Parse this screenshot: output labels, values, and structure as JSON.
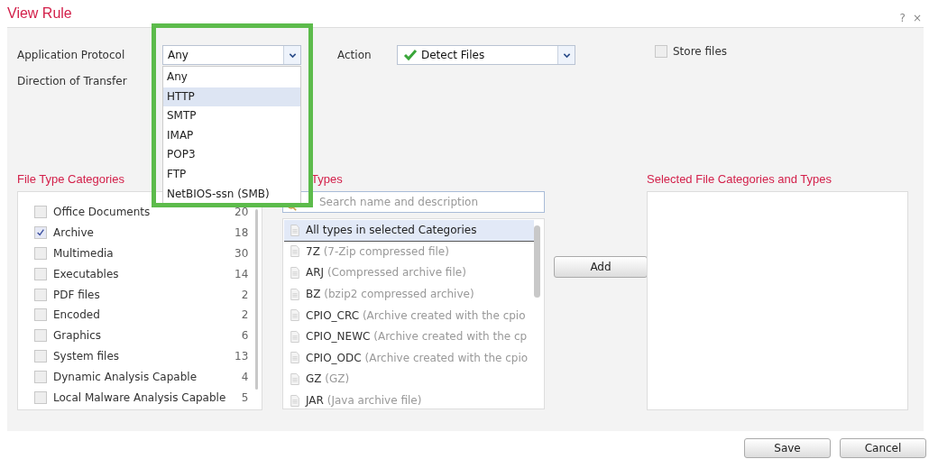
{
  "window": {
    "title": "View Rule",
    "help": "?",
    "close": "×"
  },
  "form": {
    "protocol_label": "Application Protocol",
    "protocol_value": "Any",
    "action_label": "Action",
    "action_value": "Detect Files",
    "store_files": {
      "label": "Store files",
      "checked": false
    },
    "direction_label": "Direction of Transfer"
  },
  "protocol_dropdown": {
    "highlighted": true,
    "options": [
      {
        "label": "Any",
        "selected": false
      },
      {
        "label": "HTTP",
        "selected": true
      },
      {
        "label": "SMTP",
        "selected": false
      },
      {
        "label": "IMAP",
        "selected": false
      },
      {
        "label": "POP3",
        "selected": false
      },
      {
        "label": "FTP",
        "selected": false
      },
      {
        "label": "NetBIOS-ssn (SMB)",
        "selected": false
      }
    ]
  },
  "categories": {
    "heading": "File Type Categories",
    "items": [
      {
        "label": "Office Documents",
        "count": "20",
        "checked": false
      },
      {
        "label": "Archive",
        "count": "18",
        "checked": true
      },
      {
        "label": "Multimedia",
        "count": "30",
        "checked": false
      },
      {
        "label": "Executables",
        "count": "14",
        "checked": false
      },
      {
        "label": "PDF files",
        "count": "2",
        "checked": false
      },
      {
        "label": "Encoded",
        "count": "2",
        "checked": false
      },
      {
        "label": "Graphics",
        "count": "6",
        "checked": false
      },
      {
        "label": "System files",
        "count": "13",
        "checked": false
      },
      {
        "label": "Dynamic Analysis Capable",
        "count": "4",
        "checked": false
      },
      {
        "label": "Local Malware Analysis Capable",
        "count": "5",
        "checked": false
      }
    ]
  },
  "types": {
    "heading": "Types",
    "search_placeholder": "Search name and description",
    "items": [
      {
        "kind": "all",
        "name": "All types in selected Categories",
        "selected": true
      },
      {
        "kind": "type",
        "name": "7Z",
        "description": "(7-Zip compressed file)",
        "selected": false
      },
      {
        "kind": "type",
        "name": "ARJ",
        "description": "(Compressed archive file)",
        "selected": false
      },
      {
        "kind": "type",
        "name": "BZ",
        "description": "(bzip2 compressed archive)",
        "selected": false
      },
      {
        "kind": "type",
        "name": "CPIO_CRC",
        "description": "(Archive created with the cpio",
        "selected": false
      },
      {
        "kind": "type",
        "name": "CPIO_NEWC",
        "description": "(Archive created with the cp",
        "selected": false
      },
      {
        "kind": "type",
        "name": "CPIO_ODC",
        "description": "(Archive created with the cpio",
        "selected": false
      },
      {
        "kind": "type",
        "name": "GZ",
        "description": "(GZ)",
        "selected": false
      },
      {
        "kind": "type",
        "name": "JAR",
        "description": "(Java archive file)",
        "selected": false
      }
    ]
  },
  "add_button": "Add",
  "selected_panel": {
    "heading": "Selected File Categories and Types"
  },
  "buttons": [
    "Save",
    "Cancel"
  ]
}
